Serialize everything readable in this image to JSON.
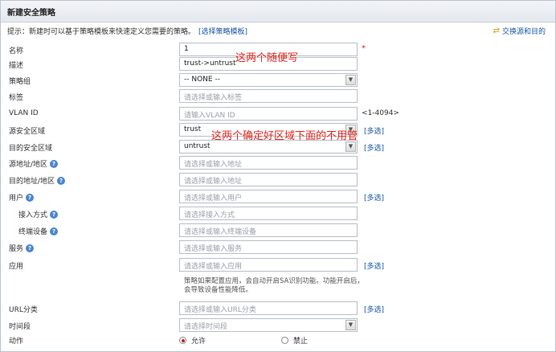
{
  "window": {
    "title": "新建安全策略"
  },
  "hint": {
    "text": "提示：新建时可以基于策略模板来快速定义您需要的策略。",
    "link": "[选择策略模板]"
  },
  "swap": {
    "label": "交换源和目的",
    "icon": "swap-icon"
  },
  "fields": {
    "name": {
      "label": "名称",
      "value": "1",
      "required": "*"
    },
    "desc": {
      "label": "描述",
      "value": "trust->untrust"
    },
    "group": {
      "label": "策略组",
      "value": "-- NONE --"
    },
    "tag": {
      "label": "标签",
      "placeholder": "请选择或输入标签"
    },
    "vlan": {
      "label": "VLAN ID",
      "placeholder": "请输入VLAN ID",
      "range": "<1-4094>"
    },
    "src_zone": {
      "label": "源安全区域",
      "value": "trust",
      "multi": "[多选]"
    },
    "dst_zone": {
      "label": "目的安全区域",
      "value": "untrust",
      "multi": "[多选]"
    },
    "src_addr": {
      "label": "源地址/地区",
      "placeholder": "请选择或输入地址"
    },
    "dst_addr": {
      "label": "目的地址/地区",
      "placeholder": "请选择或输入地址"
    },
    "user": {
      "label": "用户",
      "placeholder": "请选择或输入用户",
      "multi": "[多选]"
    },
    "access": {
      "label": "接入方式",
      "placeholder": "请选择接入方式"
    },
    "terminal": {
      "label": "终端设备",
      "placeholder": "请选择或输入终端设备"
    },
    "service": {
      "label": "服务",
      "placeholder": "请选择或输入服务"
    },
    "app": {
      "label": "应用",
      "placeholder": "请选择或输入应用",
      "multi": "[多选]"
    },
    "url": {
      "label": "URL分类",
      "placeholder": "请选择或输入URL分类",
      "multi": "[多选]"
    },
    "time": {
      "label": "时间段",
      "placeholder": "请选择时间段"
    },
    "action": {
      "label": "动作",
      "allow": "允许",
      "deny": "禁止",
      "selected": "允许"
    }
  },
  "app_note": "策略如果配置应用，会自动开启SA识别功能。功能开启后，会导致设备性能降低。",
  "annotations": {
    "a1": "这两个随便写",
    "a2": "这两个确定好区域下面的不用管"
  },
  "colors": {
    "link": "#1a55a8",
    "annotation": "#e0281f",
    "required": "#e02020"
  }
}
